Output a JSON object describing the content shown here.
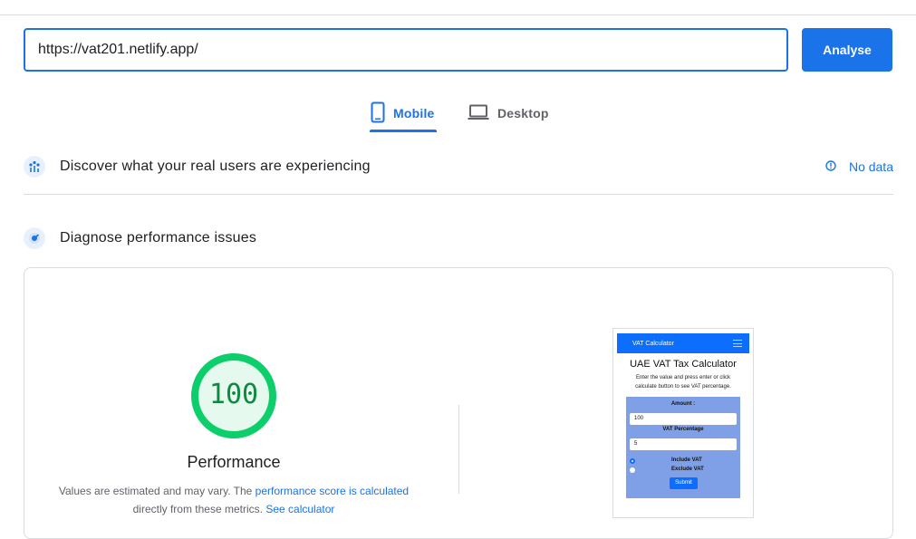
{
  "search": {
    "url_value": "https://vat201.netlify.app/",
    "analyse_label": "Analyse"
  },
  "tabs": [
    {
      "label": "Mobile",
      "icon": "smartphone-icon",
      "active": true
    },
    {
      "label": "Desktop",
      "icon": "laptop-icon",
      "active": false
    }
  ],
  "field_data": {
    "title": "Discover what your real users are experiencing",
    "icon": "users-chart-icon",
    "status_label": "No data",
    "status_icon": "info-icon"
  },
  "diagnose": {
    "title": "Diagnose performance issues",
    "icon": "speedometer-icon"
  },
  "performance": {
    "score": "100",
    "score_fraction": 1.0,
    "label": "Performance",
    "desc_prefix": "Values are estimated and may vary. The ",
    "desc_link1": "performance score is calculated",
    "desc_middle": " directly from these metrics. ",
    "desc_link2": "See calculator",
    "colors": {
      "good": "#0cce6b",
      "good_fill": "#e6f9ee",
      "good_text": "#0d8a3f"
    }
  },
  "screenshot": {
    "nav_title": "VAT Calculator",
    "heading": "UAE VAT Tax Calculator",
    "description": "Enter the value and press enter or click calculate button to see VAT percentage.",
    "amount_label": "Amount :",
    "amount_value": "100",
    "vat_label": "VAT Percentage",
    "vat_value": "5",
    "include_label": "Include VAT",
    "exclude_label": "Exclude VAT",
    "submit_label": "Submit"
  },
  "colors": {
    "accent": "#1a73e8",
    "divider": "#dadce0",
    "text_secondary": "#5f6368"
  }
}
